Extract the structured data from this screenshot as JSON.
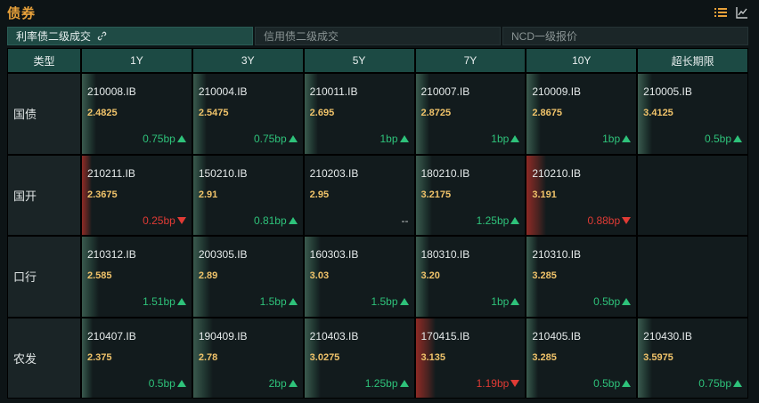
{
  "header": {
    "title": "债券"
  },
  "tabs": [
    {
      "label": "利率债二级成交",
      "active": true
    },
    {
      "label": "信用债二级成交",
      "active": false
    },
    {
      "label": "NCD一级报价",
      "active": false
    }
  ],
  "table": {
    "columns": [
      "类型",
      "1Y",
      "3Y",
      "5Y",
      "7Y",
      "10Y",
      "超长期限"
    ],
    "rows": [
      {
        "label": "国债",
        "cells": [
          {
            "code": "210008.IB",
            "yield": "2.4825",
            "change": "0.75bp",
            "dir": "up",
            "bar": "green",
            "level": 0.6
          },
          {
            "code": "210004.IB",
            "yield": "2.5475",
            "change": "0.75bp",
            "dir": "up",
            "bar": "green",
            "level": 0.6
          },
          {
            "code": "210011.IB",
            "yield": "2.695",
            "change": "1bp",
            "dir": "up",
            "bar": "green",
            "level": 0.6
          },
          {
            "code": "210007.IB",
            "yield": "2.8725",
            "change": "1bp",
            "dir": "up",
            "bar": "green",
            "level": 0.6
          },
          {
            "code": "210009.IB",
            "yield": "2.8675",
            "change": "1bp",
            "dir": "up",
            "bar": "green",
            "level": 0.6
          },
          {
            "code": "210005.IB",
            "yield": "3.4125",
            "change": "0.5bp",
            "dir": "up",
            "bar": "green",
            "level": 0.6
          }
        ]
      },
      {
        "label": "国开",
        "cells": [
          {
            "code": "210211.IB",
            "yield": "2.3675",
            "change": "0.25bp",
            "dir": "down",
            "bar": "red",
            "level": 0.3
          },
          {
            "code": "150210.IB",
            "yield": "2.91",
            "change": "0.81bp",
            "dir": "up",
            "bar": "green",
            "level": 0.6
          },
          {
            "code": "210203.IB",
            "yield": "2.95",
            "change": "--",
            "dir": "flat",
            "bar": "none",
            "level": 0
          },
          {
            "code": "180210.IB",
            "yield": "3.2175",
            "change": "1.25bp",
            "dir": "up",
            "bar": "green",
            "level": 0.8
          },
          {
            "code": "210210.IB",
            "yield": "3.191",
            "change": "0.88bp",
            "dir": "down",
            "bar": "red",
            "level": 1
          },
          {
            "code": "",
            "yield": "",
            "change": "",
            "dir": "none",
            "bar": "none",
            "level": 0
          }
        ]
      },
      {
        "label": "口行",
        "cells": [
          {
            "code": "210312.IB",
            "yield": "2.585",
            "change": "1.51bp",
            "dir": "up",
            "bar": "green",
            "level": 0.8
          },
          {
            "code": "200305.IB",
            "yield": "2.89",
            "change": "1.5bp",
            "dir": "up",
            "bar": "green",
            "level": 0.8
          },
          {
            "code": "160303.IB",
            "yield": "3.03",
            "change": "1.5bp",
            "dir": "up",
            "bar": "green",
            "level": 0.8
          },
          {
            "code": "180310.IB",
            "yield": "3.20",
            "change": "1bp",
            "dir": "up",
            "bar": "green",
            "level": 0.6
          },
          {
            "code": "210310.IB",
            "yield": "3.285",
            "change": "0.5bp",
            "dir": "up",
            "bar": "green",
            "level": 0.4
          },
          {
            "code": "",
            "yield": "",
            "change": "",
            "dir": "none",
            "bar": "none",
            "level": 0
          }
        ]
      },
      {
        "label": "农发",
        "cells": [
          {
            "code": "210407.IB",
            "yield": "2.375",
            "change": "0.5bp",
            "dir": "up",
            "bar": "green",
            "level": 0.4
          },
          {
            "code": "190409.IB",
            "yield": "2.78",
            "change": "2bp",
            "dir": "up",
            "bar": "green",
            "level": 1
          },
          {
            "code": "210403.IB",
            "yield": "3.0275",
            "change": "1.25bp",
            "dir": "up",
            "bar": "green",
            "level": 0.8
          },
          {
            "code": "170415.IB",
            "yield": "3.135",
            "change": "1.19bp",
            "dir": "down",
            "bar": "red",
            "level": 1
          },
          {
            "code": "210405.IB",
            "yield": "3.285",
            "change": "0.5bp",
            "dir": "up",
            "bar": "green",
            "level": 0.4
          },
          {
            "code": "210430.IB",
            "yield": "3.5975",
            "change": "0.75bp",
            "dir": "up",
            "bar": "green",
            "level": 0.6
          }
        ]
      }
    ]
  },
  "icons": {
    "list": "list-icon",
    "chart": "line-chart-icon",
    "link": "link-icon"
  },
  "colors": {
    "title": "#e8a13a",
    "yield": "#f0c36a",
    "up": "#2ec27a",
    "down": "#e03b35",
    "header_bg": "#1c4a44"
  }
}
